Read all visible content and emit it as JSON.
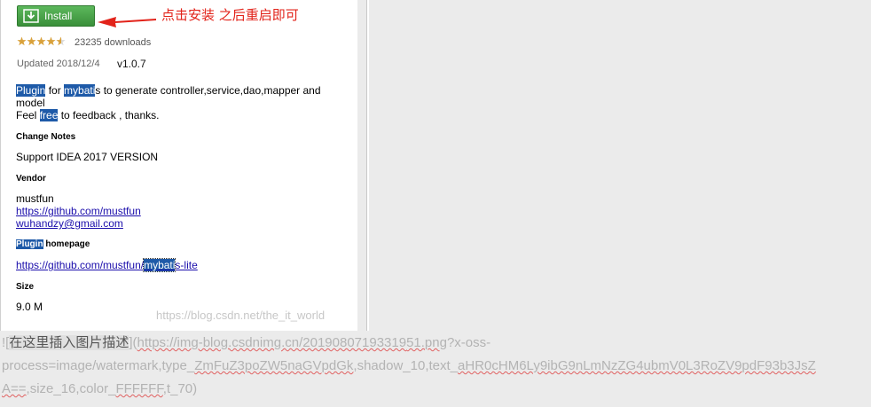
{
  "plugin": {
    "install_label": "Install",
    "annotation": "点击安装 之后重启即可",
    "rating": 4.5,
    "downloads": "23235 downloads",
    "updated": "Updated 2018/12/4",
    "version": "v1.0.7",
    "desc_plugin": "Plugin",
    "desc_for": " for ",
    "desc_mybati": "mybati",
    "desc_rest": "s to generate controller,service,dao,mapper and",
    "desc_line2": "model",
    "desc_feel": "Feel ",
    "desc_free": "free",
    "desc_thanks": " to feedback , thanks.",
    "change_notes_header": "Change Notes",
    "change_notes": "Support IDEA 2017 VERSION",
    "vendor_header": "Vendor",
    "vendor_name": "mustfun",
    "vendor_url": "https://github.com/mustfun",
    "vendor_email": "wuhandzy@gmail.com",
    "homepage_plugin": "Plugin",
    "homepage_header": " homepage",
    "homepage_url_a": "https://github.com/mustfun/",
    "homepage_url_b": "mybati",
    "homepage_url_c": "s-lite",
    "size_header": "Size",
    "size": "9.0 M"
  },
  "watermark": "https://blog.csdn.net/the_it_world",
  "editor": {
    "l1_prefix": "![",
    "l1_caption": "在这里插入图片描述",
    "l1_mid": "](",
    "l1_url": "https://img-blog.csdnimg.cn/20190807193319",
    "l1_url2": "51.png",
    "l1_tail": "?x-oss-",
    "l2_a": "process=image/watermark,type_",
    "l2_b": "ZmFuZ3poZW5naGVpdGk",
    "l2_c": ",shadow_10,text_",
    "l2_d": "aHR0cHM6Ly9ibG9nLmNzZG4ubmV0L3RoZV9pdF93b3JsZ",
    "l3_a": "A==",
    "l3_b": ",size_16,color_",
    "l3_c": "FFFFFF",
    "l3_d": ",t_70)"
  },
  "colors": {
    "install_green": "#4cae4c",
    "highlight": "#1e5aa8",
    "annotation_red": "#e2231a",
    "star": "#d9a13b"
  }
}
